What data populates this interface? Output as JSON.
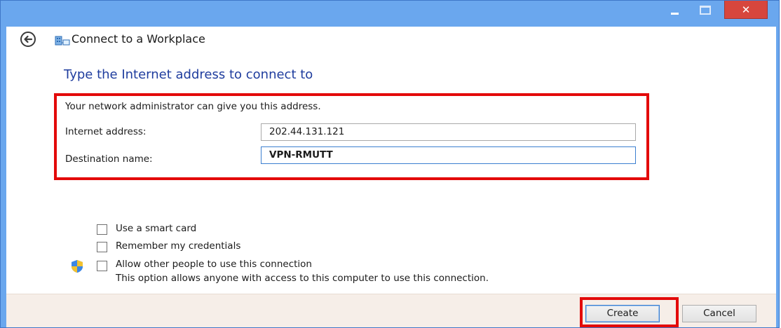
{
  "window": {
    "title": "Connect to a Workplace",
    "controls": {
      "minimize": "",
      "maximize": "",
      "close": "✕"
    }
  },
  "main": {
    "heading": "Type the Internet address to connect to",
    "hint": "Your network administrator can give you this address.",
    "internet_address": {
      "label": "Internet address:",
      "value": "202.44.131.121"
    },
    "destination_name": {
      "label": "Destination name:",
      "value": "VPN-RMUTT"
    },
    "options": [
      {
        "label": "Use a smart card",
        "checked": false
      },
      {
        "label": "Remember my credentials",
        "checked": false
      },
      {
        "label": "Allow other people to use this connection",
        "checked": false,
        "description": "This option allows anyone with access to this computer to use this connection."
      }
    ]
  },
  "footer": {
    "create_label": "Create",
    "cancel_label": "Cancel"
  },
  "colors": {
    "titlebar": "#6aa7ee",
    "heading": "#1f3d9e",
    "highlight": "#e30a0a",
    "close": "#d7463d",
    "footer": "#f6eee8"
  },
  "icons": [
    "back-arrow-icon",
    "network-workplace-icon",
    "uac-shield-icon"
  ]
}
